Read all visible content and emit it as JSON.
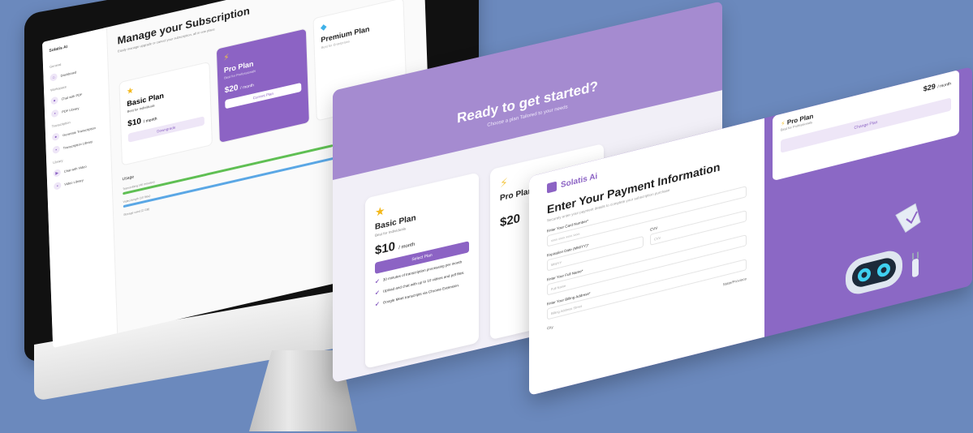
{
  "dashboard": {
    "brand": "Solatis AI",
    "nav_sections": [
      "General",
      "Workspace",
      "Transcription",
      "Library"
    ],
    "nav_items": [
      "Dashboard",
      "Chat with PDF",
      "PDF Library",
      "Generate Transcription",
      "Transcription Library",
      "Chat with Video",
      "Video Library"
    ],
    "title": "Manage your Subscription",
    "subtitle": "Easily manage upgrade or cancel your subscription, all in one place",
    "plans": [
      {
        "name": "Basic Plan",
        "best": "Best for Individuals",
        "price": "$10",
        "per": "/ month",
        "button": "Downgrade"
      },
      {
        "name": "Pro Plan",
        "best": "Best for Professionals",
        "price": "$20",
        "per": "/ month",
        "button": "Current Plan"
      },
      {
        "name": "Premium Plan",
        "best": "Best for Enterprises",
        "price": "",
        "per": "",
        "button": ""
      }
    ],
    "usage_title": "Usage",
    "usage_rows": [
      "Transcribing (40 minutes)",
      "Video length (10 files)",
      "Storage used (2 GB)"
    ],
    "colors": {
      "accent": "#8c63c4",
      "green": "#5fbf53",
      "blue": "#5aa7e5"
    }
  },
  "pricing": {
    "title": "Ready to get started?",
    "subtitle": "Choose a plan Tailored to your needs",
    "basic": {
      "name": "Basic Plan",
      "best": "Best for Individuals",
      "price": "$10",
      "per": "/ month",
      "button": "Select Plan",
      "features": [
        "30 minutes of transcription processing per month",
        "Upload and chat with up to 10 videos and pdf files.",
        "Google Meet transcripts via Chrome Extension."
      ]
    },
    "pro": {
      "name": "Pro Plan",
      "price": "$20"
    }
  },
  "payment": {
    "brand": "Solatis Ai",
    "title": "Enter Your Payment Information",
    "subtitle": "Securely enter your payment details to complete your subscription purchase",
    "fields": {
      "card": "Enter Your Card Number*",
      "card_ph": "xxxx xxxx xxxx xxxx",
      "expiry": "Expiration Date (MM/YY)*",
      "expiry_ph": "MM/YY",
      "cvv": "CVV",
      "cvv_ph": "CVV",
      "name": "Enter Your Full Name*",
      "name_ph": "Full Name",
      "address": "Enter Your Billing Address*",
      "address_ph": "Billing Address Street",
      "city": "City",
      "state": "State/Province"
    },
    "plan_box": {
      "name": "Pro Plan",
      "best": "Best for Professionals",
      "price": "$29",
      "per": "/ month",
      "button": "Change Plan"
    }
  }
}
